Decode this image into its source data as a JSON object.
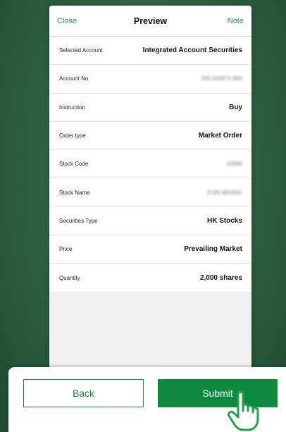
{
  "nav": {
    "close_label": "Close",
    "title": "Preview",
    "note_label": "Note"
  },
  "rows": [
    {
      "label": "Selected Account",
      "value": "Integrated Account Securities",
      "blurred": false
    },
    {
      "label": "Account No.",
      "value": "395-043672-883",
      "blurred": true
    },
    {
      "label": "Instruction",
      "value": "Buy",
      "blurred": false
    },
    {
      "label": "Order type",
      "value": "Market Order",
      "blurred": false
    },
    {
      "label": "Stock Code",
      "value": "02899",
      "blurred": true
    },
    {
      "label": "Stock Name",
      "value": "ZIJIN MINING",
      "blurred": true
    },
    {
      "label": "Securities Type",
      "value": "HK Stocks",
      "blurred": false
    },
    {
      "label": "Price",
      "value": "Prevailing Market",
      "blurred": false
    },
    {
      "label": "Quantity",
      "value": "2,000 shares",
      "blurred": false
    }
  ],
  "actions": {
    "back_label": "Back",
    "submit_label": "Submit"
  },
  "colors": {
    "accent": "#0e8a3e",
    "link": "#1f9a47",
    "background": "#2d5f3f"
  },
  "icons": {
    "pointer": "pointing-hand-icon"
  }
}
